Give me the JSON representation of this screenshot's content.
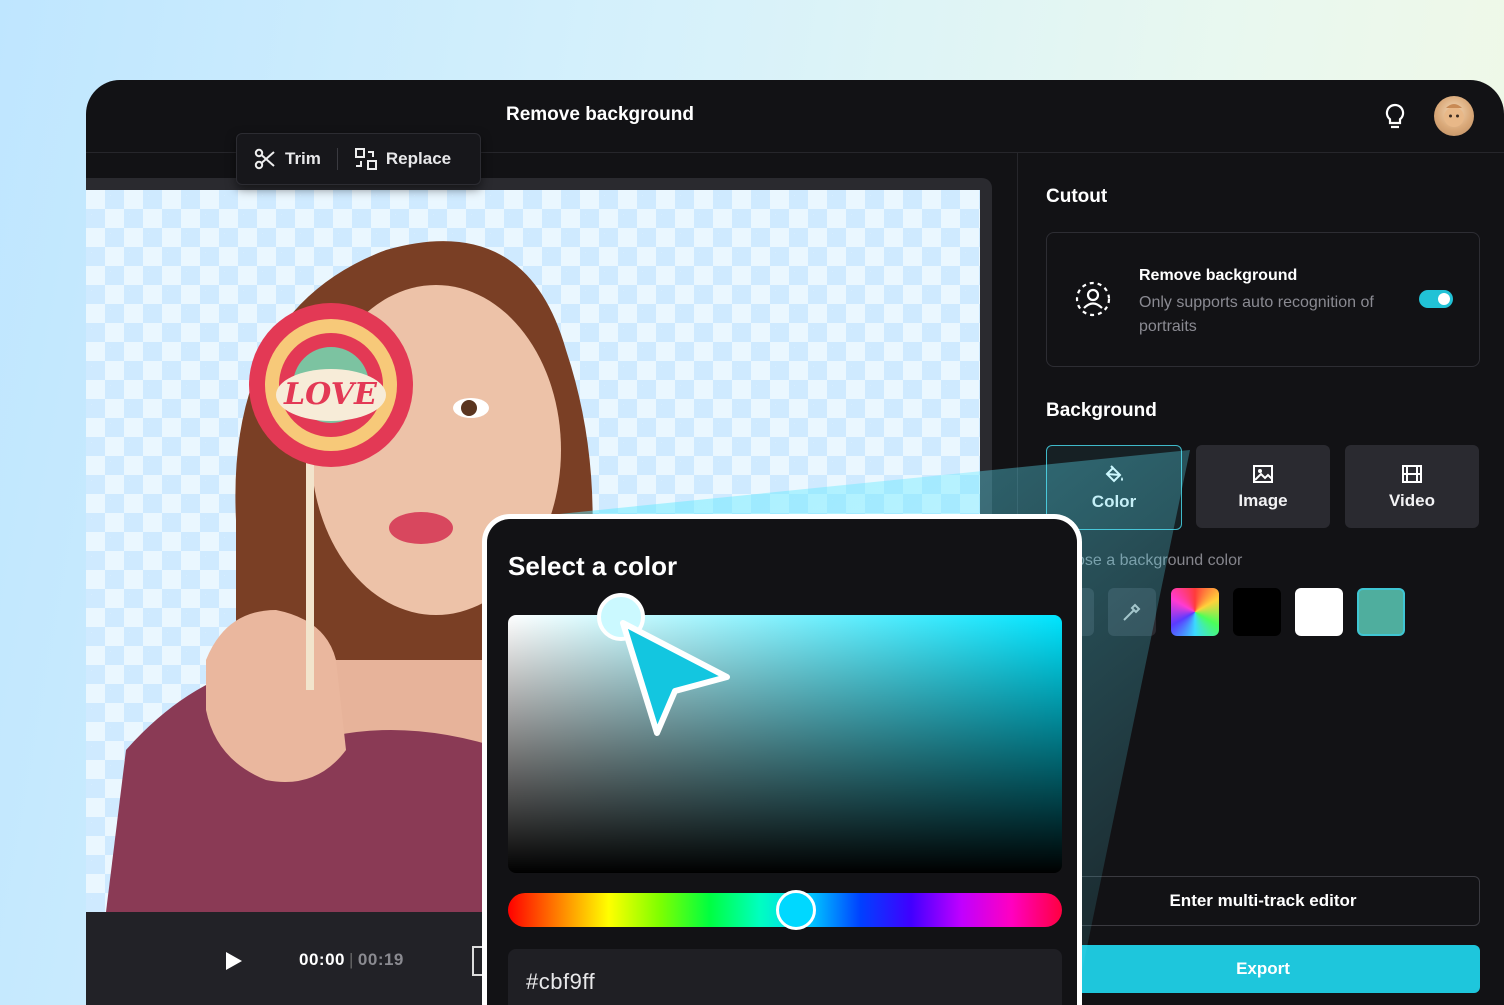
{
  "header": {
    "title": "Remove background"
  },
  "toolbar": {
    "trim_label": "Trim",
    "replace_label": "Replace"
  },
  "player": {
    "current_time": "00:00",
    "total_time": "00:19"
  },
  "panel": {
    "cutout_heading": "Cutout",
    "cutout_card": {
      "title": "Remove background",
      "description": "Only supports auto recognition of portraits",
      "toggle_on": true
    },
    "background_heading": "Background",
    "background_tabs": [
      {
        "label": "Color",
        "icon": "paint-bucket-icon",
        "selected": true
      },
      {
        "label": "Image",
        "icon": "image-icon",
        "selected": false
      },
      {
        "label": "Video",
        "icon": "film-icon",
        "selected": false
      }
    ],
    "hint": "ose a background color",
    "swatches": [
      "#000000",
      "#ffffff",
      "#4fae9e"
    ],
    "multitrack_label": "Enter multi-track editor",
    "export_label": "Export"
  },
  "color_picker": {
    "title": "Select a color",
    "hex_prefix": "#",
    "hex_value": "cbf9ff",
    "accent": "#00e5ff"
  },
  "colors": {
    "accent": "#1ec6dc",
    "app_bg": "#121215"
  }
}
